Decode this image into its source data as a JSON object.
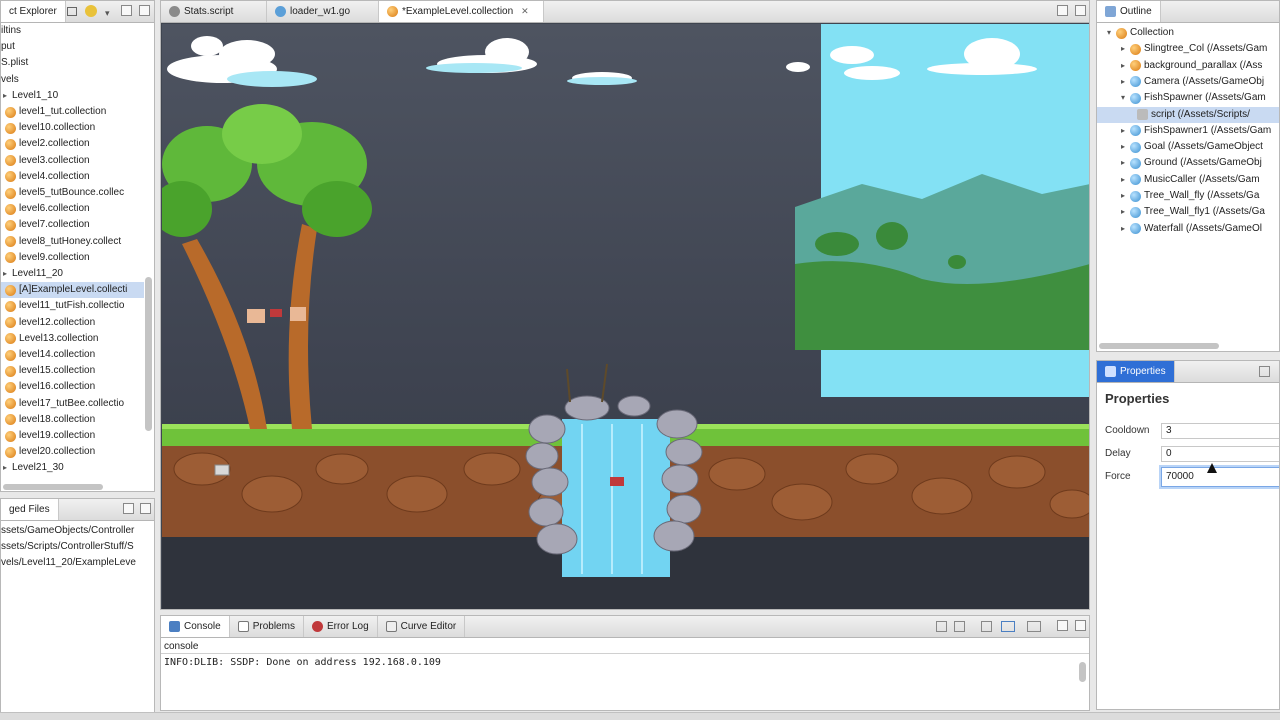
{
  "project_explorer": {
    "title": "ct Explorer",
    "rows": [
      {
        "label": "iltins",
        "kind": "text"
      },
      {
        "label": "put",
        "kind": "text"
      },
      {
        "label": "S.plist",
        "kind": "text"
      },
      {
        "label": "vels",
        "kind": "text"
      },
      {
        "label": "Level1_10",
        "kind": "folder"
      },
      {
        "label": "level1_tut.collection",
        "kind": "orange"
      },
      {
        "label": "level10.collection",
        "kind": "orange"
      },
      {
        "label": "level2.collection",
        "kind": "orange"
      },
      {
        "label": "level3.collection",
        "kind": "orange"
      },
      {
        "label": "level4.collection",
        "kind": "orange"
      },
      {
        "label": "level5_tutBounce.collec",
        "kind": "orange"
      },
      {
        "label": "level6.collection",
        "kind": "orange"
      },
      {
        "label": "level7.collection",
        "kind": "orange"
      },
      {
        "label": "level8_tutHoney.collect",
        "kind": "orange"
      },
      {
        "label": "level9.collection",
        "kind": "orange"
      },
      {
        "label": "Level11_20",
        "kind": "folder"
      },
      {
        "label": "[A]ExampleLevel.collecti",
        "kind": "orange",
        "selected": true
      },
      {
        "label": "level11_tutFish.collectio",
        "kind": "orange"
      },
      {
        "label": "level12.collection",
        "kind": "orange"
      },
      {
        "label": "Level13.collection",
        "kind": "orange"
      },
      {
        "label": "level14.collection",
        "kind": "orange"
      },
      {
        "label": "level15.collection",
        "kind": "orange"
      },
      {
        "label": "level16.collection",
        "kind": "orange"
      },
      {
        "label": "level17_tutBee.collectio",
        "kind": "orange"
      },
      {
        "label": "level18.collection",
        "kind": "orange"
      },
      {
        "label": "level19.collection",
        "kind": "orange"
      },
      {
        "label": "level20.collection",
        "kind": "orange"
      },
      {
        "label": "Level21_30",
        "kind": "folder"
      }
    ]
  },
  "changed_files": {
    "title": "ged Files",
    "rows": [
      "ssets/GameObjects/Controller",
      "ssets/Scripts/ControllerStuff/S",
      "vels/Level11_20/ExampleLeve"
    ]
  },
  "editor_tabs": [
    {
      "label": "Stats.script",
      "active": false
    },
    {
      "label": "loader_w1.go",
      "active": false
    },
    {
      "label": "*ExampleLevel.collection",
      "active": true
    }
  ],
  "outline": {
    "title": "Outline",
    "root": "Collection",
    "items": [
      {
        "label": "Slingtree_Col (/Assets/Gam",
        "kind": "orange",
        "expanded": false
      },
      {
        "label": "background_parallax (/Ass",
        "kind": "orange",
        "expanded": false
      },
      {
        "label": "Camera (/Assets/GameObj",
        "kind": "blue",
        "expanded": false
      },
      {
        "label": "FishSpawner (/Assets/Gam",
        "kind": "blue",
        "expanded": true
      },
      {
        "label": "script (/Assets/Scripts/",
        "kind": "script",
        "child": true,
        "selected": true
      },
      {
        "label": "FishSpawner1 (/Assets/Gam",
        "kind": "blue",
        "expanded": false
      },
      {
        "label": "Goal (/Assets/GameObject",
        "kind": "blue",
        "expanded": false
      },
      {
        "label": "Ground (/Assets/GameObj",
        "kind": "blue",
        "expanded": false
      },
      {
        "label": "MusicCaller (/Assets/Gam",
        "kind": "blue",
        "expanded": false
      },
      {
        "label": "Tree_Wall_fly (/Assets/Ga",
        "kind": "blue",
        "expanded": false
      },
      {
        "label": "Tree_Wall_fly1 (/Assets/Ga",
        "kind": "blue",
        "expanded": false
      },
      {
        "label": "Waterfall (/Assets/GameOl",
        "kind": "blue",
        "expanded": false
      }
    ]
  },
  "properties": {
    "tab_title": "Properties",
    "heading": "Properties",
    "fields": [
      {
        "label": "Cooldown",
        "value": "3"
      },
      {
        "label": "Delay",
        "value": "0"
      },
      {
        "label": "Force",
        "value": "70000"
      }
    ]
  },
  "bottom_tabs": [
    {
      "label": "Console",
      "active": true
    },
    {
      "label": "Problems",
      "active": false
    },
    {
      "label": "Error Log",
      "active": false
    },
    {
      "label": "Curve Editor",
      "active": false
    }
  ],
  "console": {
    "name": "console",
    "line": "INFO:DLIB: SSDP: Done on address 192.168.0.109"
  },
  "colors": {
    "sky_dark": "#3f4550",
    "sky_light": "#7fe0f3",
    "grass": "#6fc23a",
    "dirt": "#8b4f2c",
    "water": "#6fd0f0",
    "selection": "#c9daf2"
  }
}
